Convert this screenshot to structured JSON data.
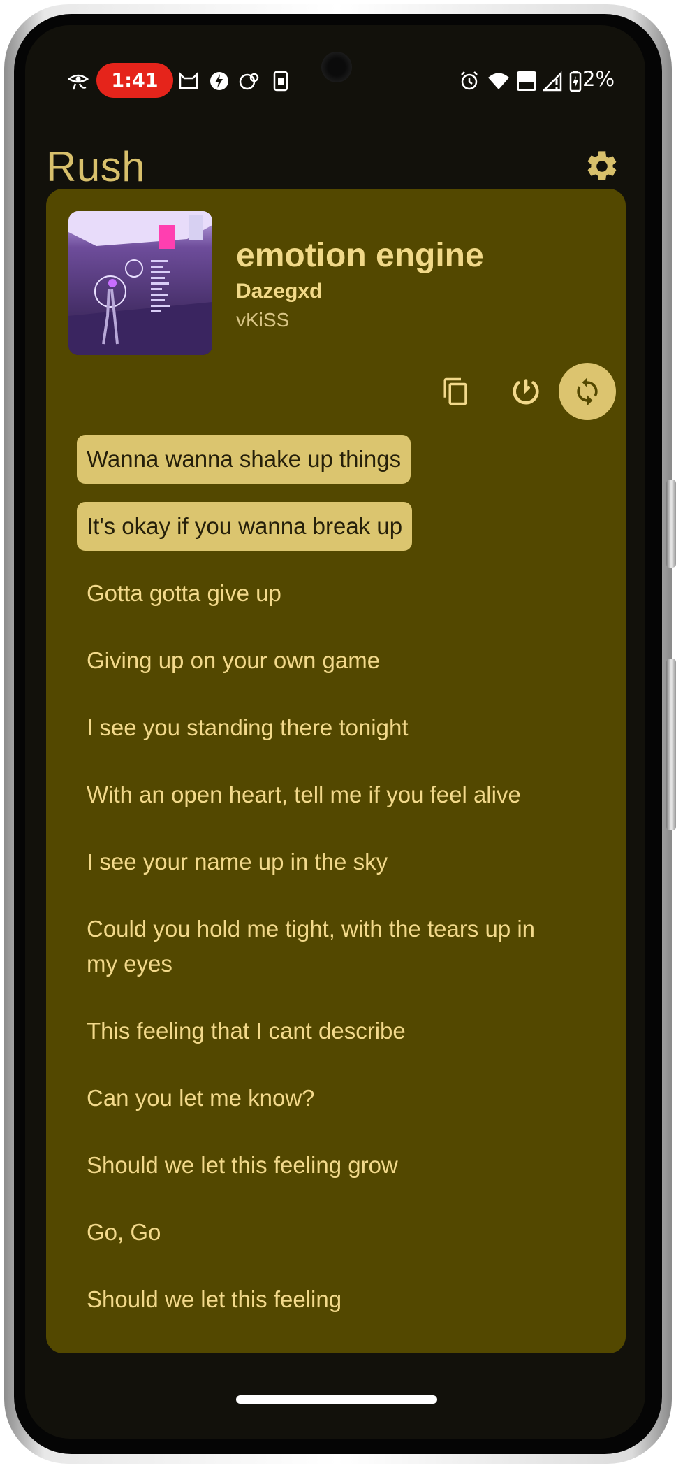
{
  "status_bar": {
    "time": "1:41",
    "battery": "2%",
    "icons": [
      "eye-of-horus-icon",
      "cat-icon",
      "bolt-icon",
      "steam-icon",
      "sim-card-icon",
      "alarm-icon",
      "wifi-icon",
      "volte-icon",
      "signal-icon",
      "battery-charging-icon"
    ]
  },
  "app": {
    "title": "Rush",
    "settings_icon": "gear-icon"
  },
  "now_playing": {
    "title": "emotion engine",
    "artist": "Dazegxd",
    "album": "vKiSS"
  },
  "actions": {
    "copy_icon": "copy-icon",
    "sync_icon": "timer-icon",
    "refresh_icon": "refresh-icon",
    "refresh_active": true
  },
  "lyrics": [
    {
      "text": "Wanna wanna shake up things",
      "highlighted": true
    },
    {
      "text": "It's okay if you wanna break up",
      "highlighted": true
    },
    {
      "text": "Gotta gotta give up",
      "highlighted": false
    },
    {
      "text": "Giving up on your own game",
      "highlighted": false
    },
    {
      "text": "I see you standing there tonight",
      "highlighted": false
    },
    {
      "text": "With an open heart, tell me if you feel alive",
      "highlighted": false
    },
    {
      "text": "I see your name up in the sky",
      "highlighted": false
    },
    {
      "text": "Could you hold me tight, with the tears up in my eyes",
      "highlighted": false
    },
    {
      "text": "This feeling that I cant describe",
      "highlighted": false
    },
    {
      "text": "Can you let me know?",
      "highlighted": false
    },
    {
      "text": "Should we let this feeling grow",
      "highlighted": false
    },
    {
      "text": "Go, Go",
      "highlighted": false
    },
    {
      "text": "Should we let this feeling",
      "highlighted": false
    }
  ],
  "colors": {
    "background": "#12110b",
    "card": "#534800",
    "accent": "#d8c06c",
    "highlight": "#dbc56f",
    "lyric_text": "#f2d98b"
  }
}
